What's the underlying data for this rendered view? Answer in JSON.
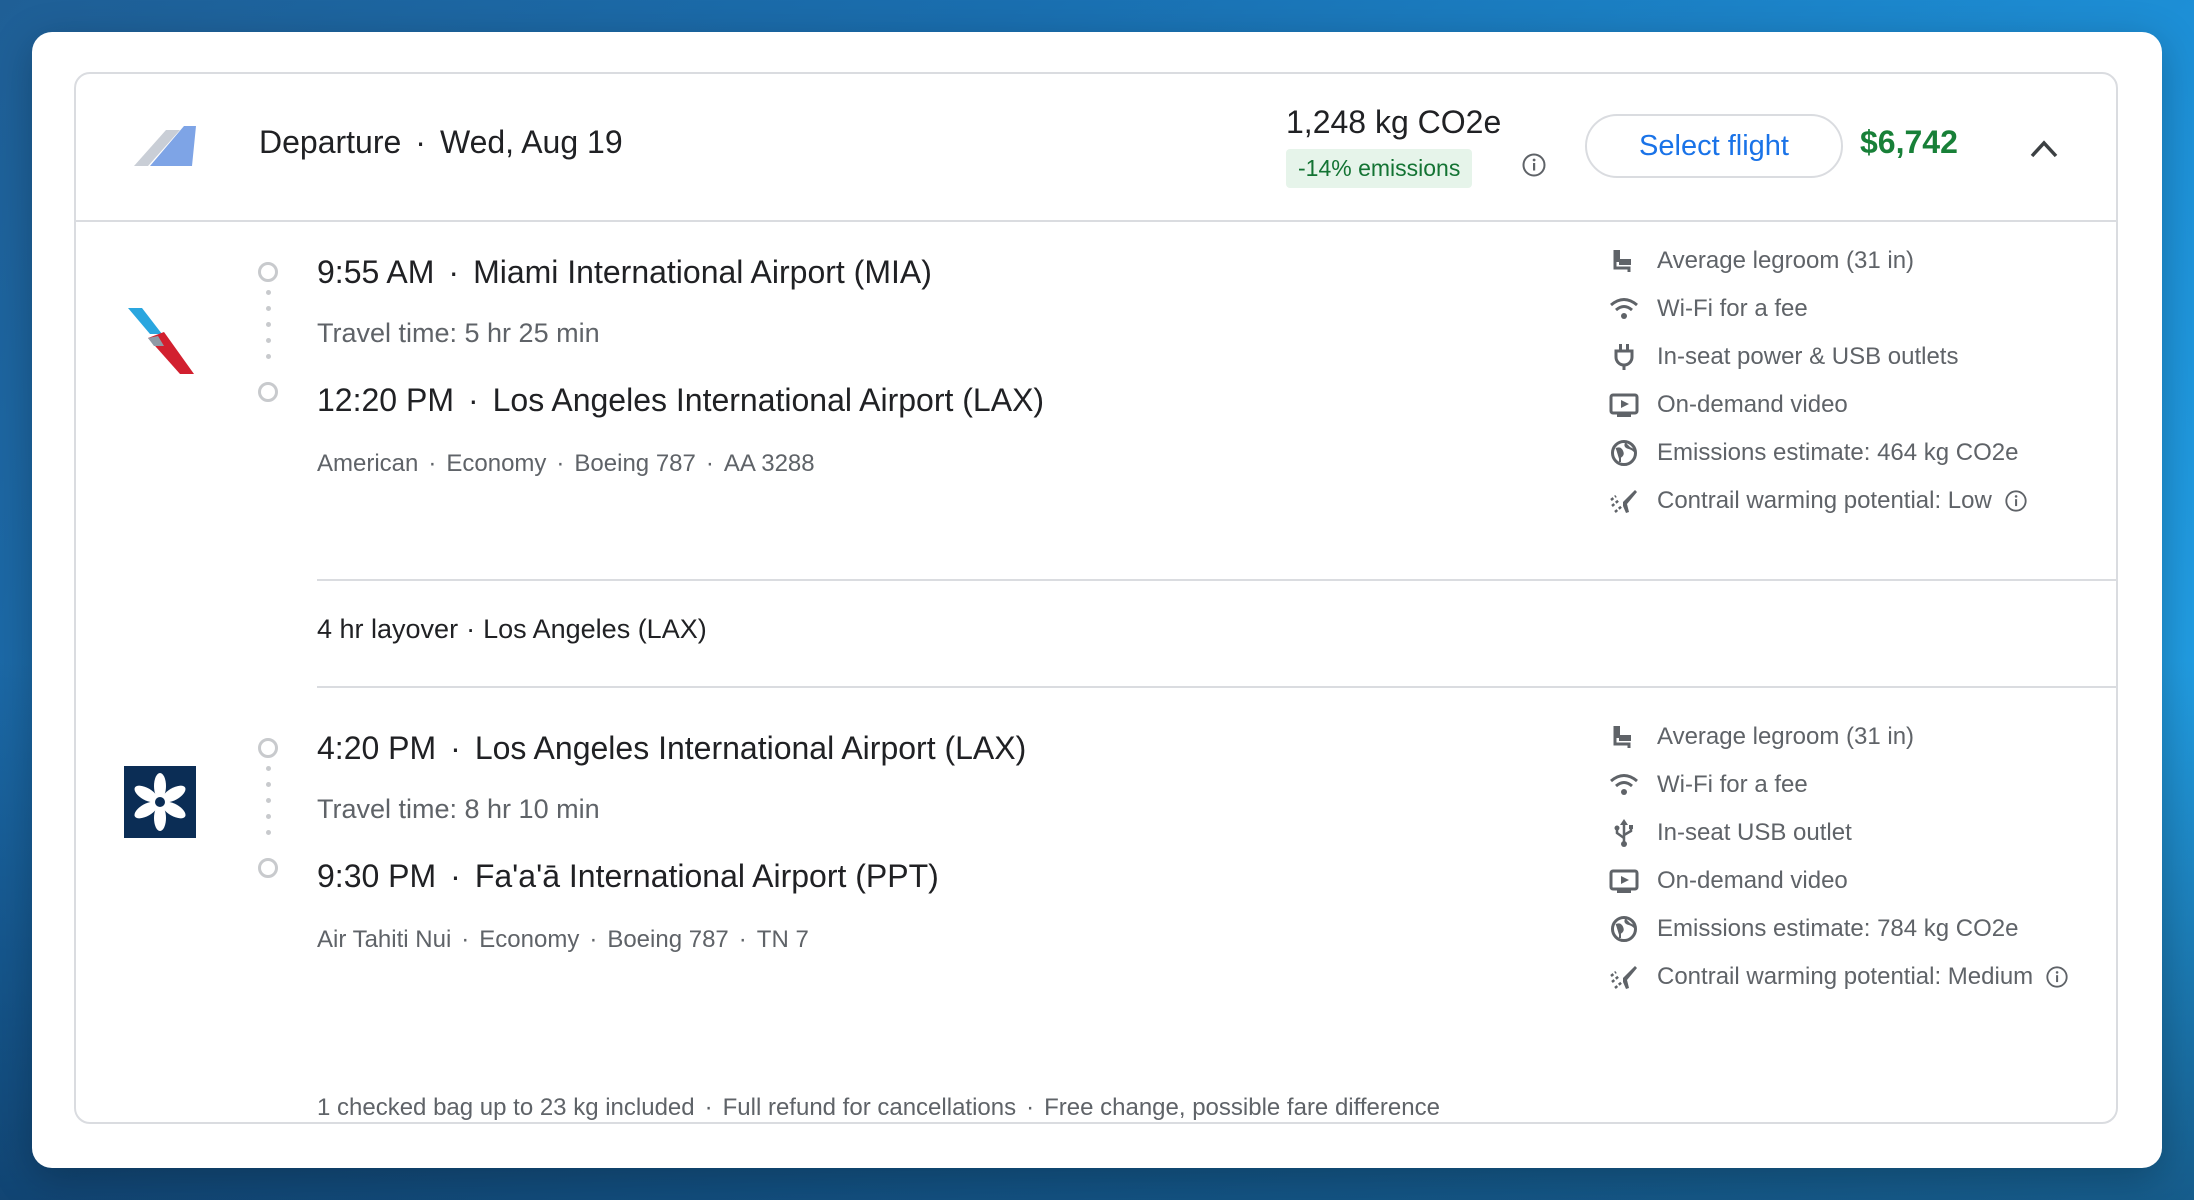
{
  "header": {
    "label": "Departure",
    "date": "Wed, Aug 19",
    "co2": "1,248 kg CO2e",
    "emissions_badge": "-14% emissions",
    "select_label": "Select flight",
    "price": "$6,742"
  },
  "segments": [
    {
      "depart_time": "9:55 AM",
      "depart_airport": "Miami International Airport (MIA)",
      "travel_time": "Travel time: 5 hr 25 min",
      "arrive_time": "12:20 PM",
      "arrive_airport": "Los Angeles International Airport (LAX)",
      "meta": [
        "American",
        "Economy",
        "Boeing 787",
        "AA 3288"
      ],
      "amenities": [
        {
          "icon": "legroom-icon",
          "text": "Average legroom (31 in)"
        },
        {
          "icon": "wifi-icon",
          "text": "Wi-Fi for a fee"
        },
        {
          "icon": "power-plug-icon",
          "text": "In-seat power & USB outlets"
        },
        {
          "icon": "video-icon",
          "text": "On-demand video"
        },
        {
          "icon": "globe-icon",
          "text": "Emissions estimate: 464 kg CO2e"
        },
        {
          "icon": "contrail-icon",
          "text": "Contrail warming potential: Low"
        }
      ]
    },
    {
      "depart_time": "4:20 PM",
      "depart_airport": "Los Angeles International Airport (LAX)",
      "travel_time": "Travel time: 8 hr 10 min",
      "arrive_time": "9:30 PM",
      "arrive_airport": "Fa'a'ā International Airport (PPT)",
      "meta": [
        "Air Tahiti Nui",
        "Economy",
        "Boeing 787",
        "TN 7"
      ],
      "amenities": [
        {
          "icon": "legroom-icon",
          "text": "Average legroom (31 in)"
        },
        {
          "icon": "wifi-icon",
          "text": "Wi-Fi for a fee"
        },
        {
          "icon": "usb-icon",
          "text": "In-seat USB outlet"
        },
        {
          "icon": "video-icon",
          "text": "On-demand video"
        },
        {
          "icon": "globe-icon",
          "text": "Emissions estimate: 784 kg CO2e"
        },
        {
          "icon": "contrail-icon",
          "text": "Contrail warming potential: Medium"
        }
      ]
    }
  ],
  "layover": {
    "duration": "4 hr layover",
    "location": "Los Angeles (LAX)"
  },
  "footer": [
    "1 checked bag up to 23 kg included",
    "Full refund for cancellations",
    "Free change, possible fare difference"
  ],
  "colors": {
    "price_green": "#188038",
    "badge_bg": "#e6f4ea",
    "badge_text": "#137333",
    "link_blue": "#1a73e8"
  }
}
